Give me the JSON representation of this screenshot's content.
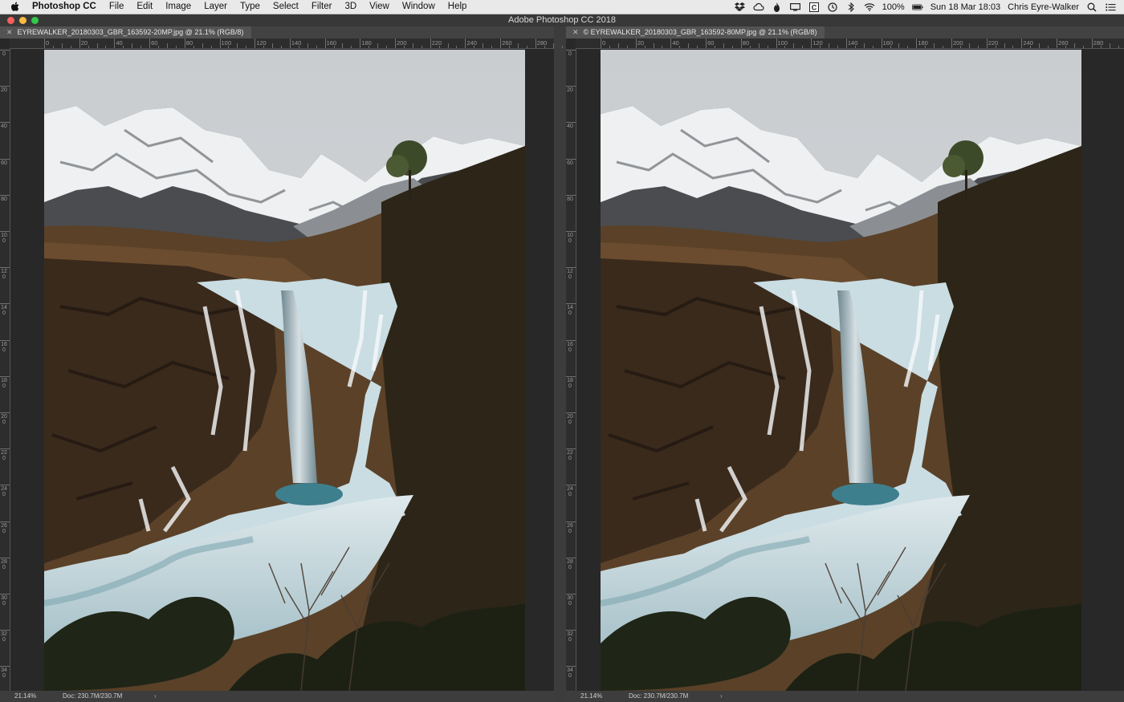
{
  "menubar": {
    "app_name": "Photoshop CC",
    "items": [
      "File",
      "Edit",
      "Image",
      "Layer",
      "Type",
      "Select",
      "Filter",
      "3D",
      "View",
      "Window",
      "Help"
    ],
    "battery": "100%",
    "datetime": "Sun 18 Mar  18:03",
    "user": "Chris Eyre-Walker"
  },
  "window": {
    "title": "Adobe Photoshop CC 2018",
    "traffic_colors": [
      "#fc605c",
      "#fdbc40",
      "#34c84a"
    ]
  },
  "documents": [
    {
      "tab_title": "EYREWALKER_20180303_GBR_163592-20MP.jpg @ 21.1% (RGB/8)",
      "ruler_labels": [
        "0",
        "20",
        "40",
        "60",
        "80",
        "100",
        "120",
        "140",
        "160",
        "180",
        "200",
        "220",
        "240",
        "260",
        "280"
      ],
      "vruler_labels": [
        "0",
        "20",
        "40",
        "60",
        "80",
        "100",
        "120",
        "140",
        "160",
        "180",
        "200",
        "220",
        "240",
        "260",
        "280",
        "300",
        "320",
        "340"
      ],
      "zoom": "21.14%",
      "doc_size": "Doc: 230.7M/230.7M"
    },
    {
      "tab_title": "© EYREWALKER_20180303_GBR_163592-80MP.jpg @ 21.1% (RGB/8)",
      "ruler_labels": [
        "0",
        "20",
        "40",
        "60",
        "80",
        "100",
        "120",
        "140",
        "160",
        "180",
        "200",
        "220",
        "240",
        "260",
        "280"
      ],
      "vruler_labels": [
        "0",
        "20",
        "40",
        "60",
        "80",
        "100",
        "120",
        "140",
        "160",
        "180",
        "200",
        "220",
        "240",
        "260",
        "280",
        "300",
        "320",
        "340"
      ],
      "zoom": "21.14%",
      "doc_size": "Doc: 230.7M/230.7M"
    }
  ],
  "colors": {
    "sky": "#d6d9db",
    "snow": "#eef0f2",
    "rock": "#3a2a1c",
    "moss": "#2c2518",
    "ice": "#c9dde3",
    "pool": "#3e7f8e"
  }
}
